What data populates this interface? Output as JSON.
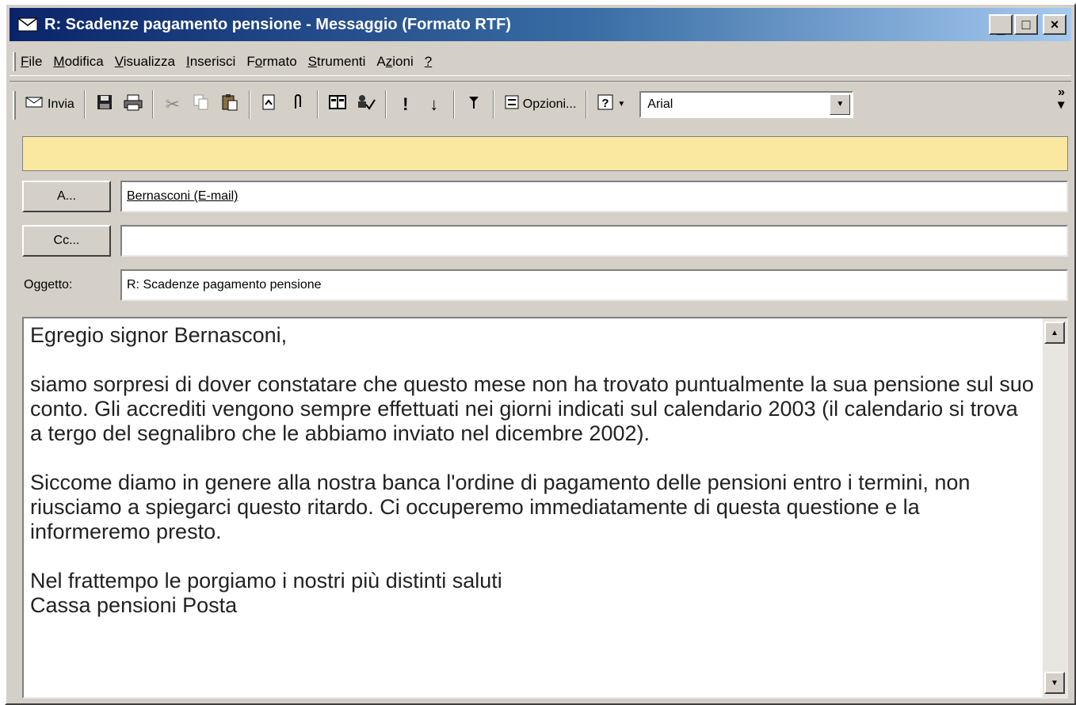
{
  "window": {
    "title": "R: Scadenze pagamento pensione - Messaggio (Formato RTF)",
    "icon": "envelope-icon"
  },
  "menu": [
    {
      "key": "F",
      "rest": "ile"
    },
    {
      "key": "M",
      "rest": "odifica"
    },
    {
      "key": "V",
      "rest": "isualizza"
    },
    {
      "key": "I",
      "rest": "nserisci"
    },
    {
      "pre": "F",
      "key": "o",
      "rest": "rmato"
    },
    {
      "key": "S",
      "rest": "trumenti"
    },
    {
      "pre": "A",
      "key": "z",
      "rest": "ioni"
    },
    {
      "key": "?",
      "rest": ""
    }
  ],
  "toolbar": {
    "send_label": "Invia",
    "options_label": "Opzioni...",
    "font_name": "Arial",
    "icons": [
      "save-icon",
      "print-icon",
      "cut-icon",
      "copy-icon",
      "paste-icon",
      "insert-file-icon",
      "attach-icon",
      "address-book-icon",
      "check-names-icon",
      "high-importance-icon",
      "low-importance-icon",
      "flag-icon",
      "options-icon",
      "help-icon"
    ]
  },
  "fields": {
    "to_button": "A...",
    "to_value": "Bernasconi (E-mail)",
    "cc_button": "Cc...",
    "cc_value": "",
    "subject_label": "Oggetto:",
    "subject_value": "R: Scadenze pagamento pensione"
  },
  "body": {
    "greeting": "Egregio signor Bernasconi,",
    "paragraph1": "siamo sorpresi di dover constatare che questo mese non ha trovato puntualmente la sua pensione sul suo conto. Gli accrediti vengono sempre effettuati nei giorni indicati sul calendario 2003 (il calendario si trova a tergo del segnalibro che le abbiamo inviato nel dicembre 2002).",
    "paragraph2": "Siccome diamo in genere alla nostra banca l'ordine di pagamento delle pensioni entro i termini, non riusciamo a spiegarci questo ritardo. Ci occuperemo immediatamente di questa questione e la informeremo presto.",
    "closing": "Nel frattempo le porgiamo i nostri più distinti saluti",
    "signature": "Cassa pensioni Posta"
  },
  "colors": {
    "titlebar_start": "#0a246a",
    "titlebar_end": "#a6caf0",
    "infobar": "#fbe8a0",
    "chrome": "#d4d0c8"
  }
}
